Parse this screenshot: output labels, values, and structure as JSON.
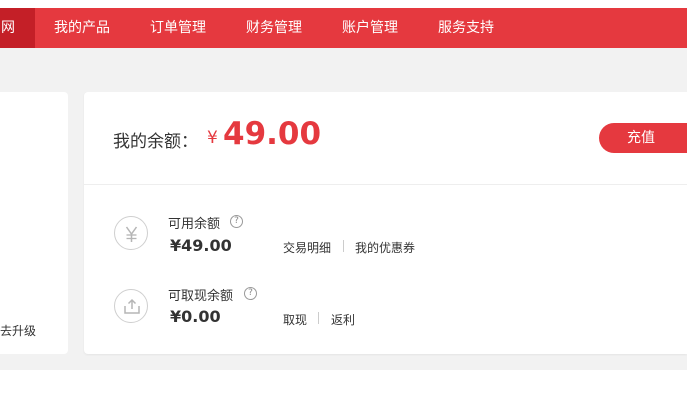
{
  "nav": {
    "home_partial": "网",
    "items": [
      "我的产品",
      "订单管理",
      "财务管理",
      "账户管理",
      "服务支持"
    ]
  },
  "left_card": {
    "upgrade_partial": "去升级"
  },
  "balance": {
    "label": "我的余额：",
    "currency": "¥",
    "amount": "49.00",
    "recharge_label": "充值"
  },
  "available": {
    "title": "可用余额",
    "value": "¥49.00",
    "links": [
      "交易明细",
      "我的优惠券"
    ],
    "icon": "yen-icon"
  },
  "withdrawable": {
    "title": "可取现余额",
    "value": "¥0.00",
    "links": [
      "取现",
      "返利"
    ],
    "icon": "upload-icon"
  },
  "colors": {
    "brand_red": "#e5393f",
    "dark_red": "#c41f27",
    "background": "#f2f2f2"
  }
}
